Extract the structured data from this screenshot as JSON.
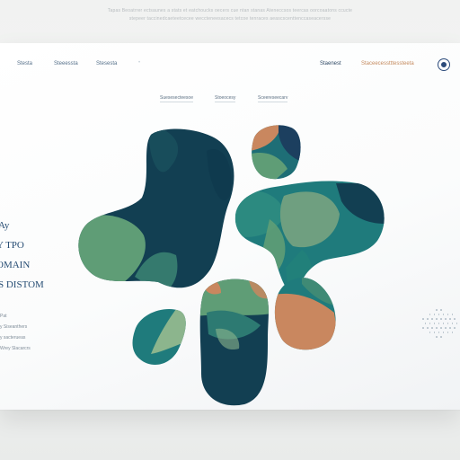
{
  "caption": {
    "line1": "Tapas Beoatrrer ectsaunes a stats et eatchoucks oecers cue ntan stanas Ateneccsos teercas oorcoaatons ccucte",
    "line2": "stepeer taccinedcaeteetcecee weccteneesacecs tetcoe tenraces aeascscenttenccaseacersse"
  },
  "nav": {
    "links": [
      "Stesta",
      "Steeessta",
      "Stesesta"
    ],
    "dot": "•",
    "right_link_1": "Staenest",
    "right_link_2": "Staceecesstttessteeta"
  },
  "subnav": {
    "links": [
      "Suesesecteesoe",
      "Stoeocesy",
      "Sceereseecarv"
    ]
  },
  "hero": {
    "lines": [
      "Ay",
      "Y TPO",
      "OMAIN",
      "S DISTOM"
    ]
  },
  "sidebar_text": {
    "lines": [
      "Pat",
      "y Siseanthers",
      "y sacterueas",
      "Wrey Slacarcrs"
    ]
  },
  "colors": {
    "navy": "#123f52",
    "teal": "#1f7b7c",
    "sage": "#5f9d76",
    "light_sage": "#8cb58d",
    "terracotta": "#c9875f",
    "deep_blue": "#1c3f5f"
  }
}
